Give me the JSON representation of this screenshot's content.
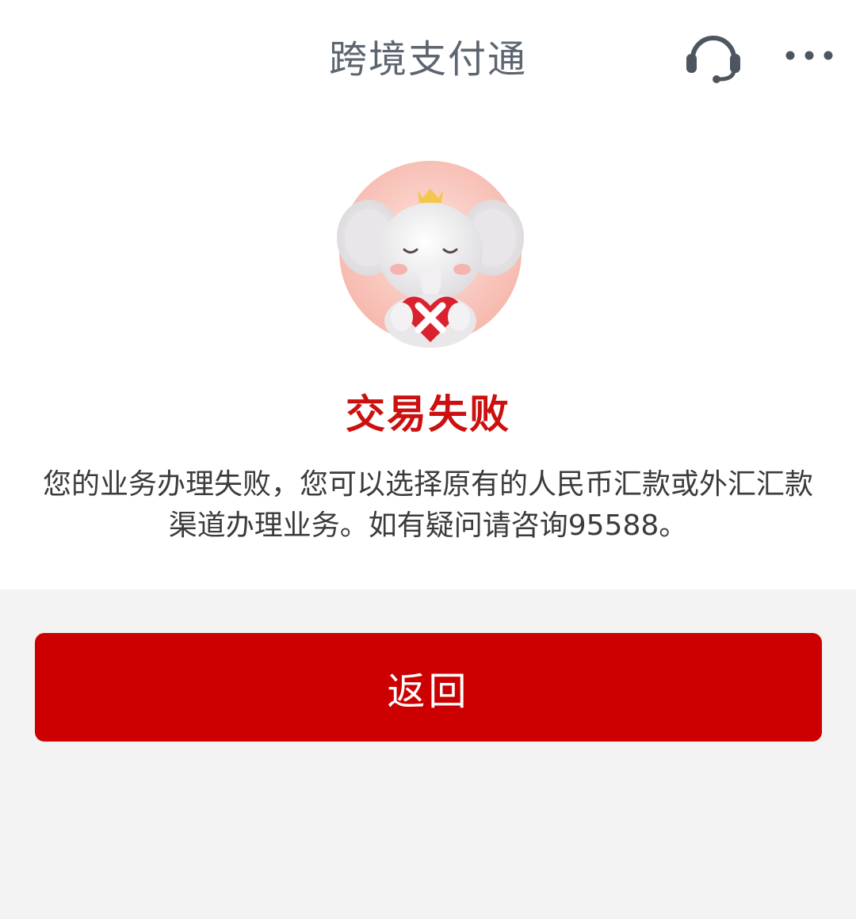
{
  "header": {
    "title": "跨境支付通",
    "support_icon": "headset-icon",
    "more_icon": "more-dots-icon"
  },
  "result": {
    "illustration": "elephant-mascot-failure-icon",
    "title": "交易失败",
    "message": "您的业务办理失败，您可以选择原有的人民币汇款或外汇汇款渠道办理业务。如有疑问请咨询95588。"
  },
  "actions": {
    "back_label": "返回"
  },
  "colors": {
    "accent": "#cc0000",
    "title_red": "#cc1010",
    "header_text": "#5d6670",
    "body_text": "#3b3b3b",
    "background": "#f3f3f3"
  }
}
